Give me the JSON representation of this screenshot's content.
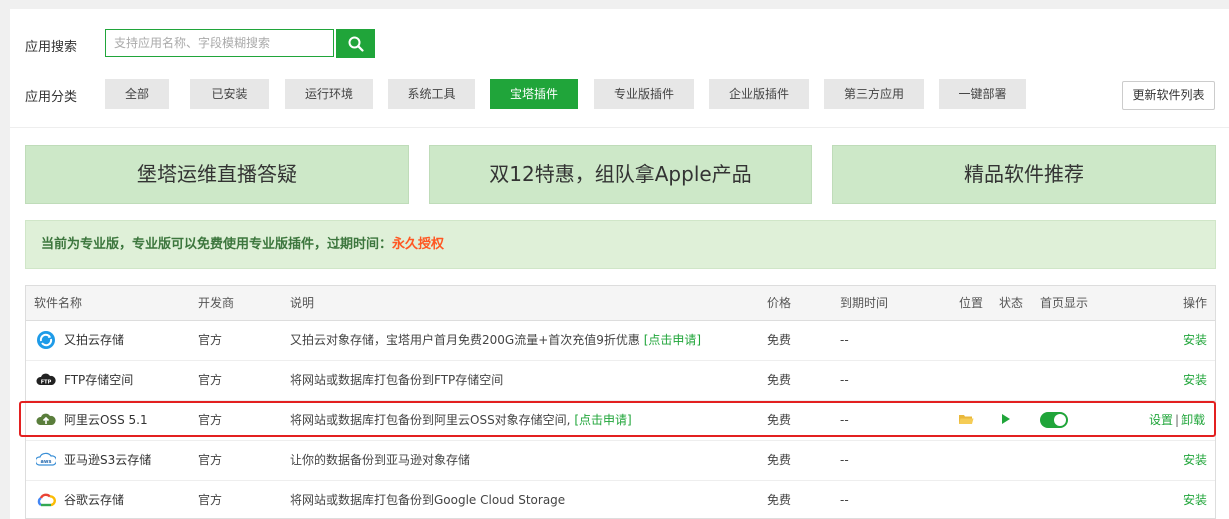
{
  "search": {
    "label": "应用搜索",
    "placeholder": "支持应用名称、字段模糊搜索",
    "value": ""
  },
  "category": {
    "label": "应用分类",
    "tabs": [
      "全部",
      "已安装",
      "运行环境",
      "系统工具",
      "宝塔插件",
      "专业版插件",
      "企业版插件",
      "第三方应用",
      "一键部署"
    ],
    "active": "宝塔插件",
    "update_button": "更新软件列表"
  },
  "banners": [
    "堡塔运维直播答疑",
    "双12特惠，组队拿Apple产品",
    "精品软件推荐"
  ],
  "notice": {
    "text": "当前为专业版，专业版可以免费使用专业版插件，过期时间：",
    "highlight": "永久授权"
  },
  "table": {
    "headers": {
      "name": "软件名称",
      "developer": "开发商",
      "desc": "说明",
      "price": "价格",
      "expire": "到期时间",
      "location": "位置",
      "status": "状态",
      "home": "首页显示",
      "ops": "操作"
    },
    "rows": [
      {
        "icon": "upyun-icon",
        "name": "又拍云存储",
        "developer": "官方",
        "desc": "又拍云对象存储，宝塔用户首月免费200G流量+首次充值9折优惠",
        "desc_link": "[点击申请]",
        "price": "免费",
        "expire": "--",
        "action": "安装"
      },
      {
        "icon": "ftp-icon",
        "name": "FTP存储空间",
        "developer": "官方",
        "desc": "将网站或数据库打包备份到FTP存储空间",
        "desc_link": "",
        "price": "免费",
        "expire": "--",
        "action": "安装"
      },
      {
        "icon": "aliyun-oss-icon",
        "name": "阿里云OSS 5.1",
        "developer": "官方",
        "desc": "将网站或数据库打包备份到阿里云OSS对象存储空间,",
        "desc_link": "[点击申请]",
        "price": "免费",
        "expire": "--",
        "action_set": "设置",
        "action_sep": "|",
        "action_uninstall": "卸载",
        "home_display": true
      },
      {
        "icon": "aws-s3-icon",
        "name": "亚马逊S3云存储",
        "developer": "官方",
        "desc": "让你的数据备份到亚马逊对象存储",
        "desc_link": "",
        "price": "免费",
        "expire": "--",
        "action": "安装"
      },
      {
        "icon": "google-cloud-icon",
        "name": "谷歌云存储",
        "developer": "官方",
        "desc": "将网站或数据库打包备份到Google Cloud Storage",
        "desc_link": "",
        "price": "免费",
        "expire": "--",
        "action": "安装"
      }
    ]
  },
  "colors": {
    "accent": "#20a53a",
    "highlight": "#ff5722",
    "banner_bg": "#cde8c8",
    "notice_bg": "#dff0d8",
    "red_box": "#e32020"
  }
}
